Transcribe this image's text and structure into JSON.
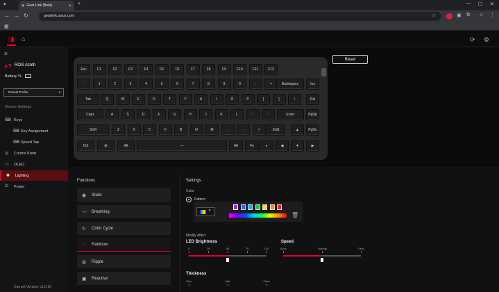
{
  "browser": {
    "tab_title": "Gear Link (Beta)",
    "url": "gearlink.asus.com"
  },
  "sidebar": {
    "brand": "ROG Azoth",
    "battery": "Battery %",
    "profile": "Default Profile",
    "section": "Device Settings",
    "items": [
      {
        "label": "Keys",
        "icon": "keyboard-icon"
      },
      {
        "label": "Key Assignment",
        "icon": "key-assign-icon"
      },
      {
        "label": "Speed Tap",
        "icon": "speed-tap-icon"
      },
      {
        "label": "Control Knob",
        "icon": "knob-icon"
      },
      {
        "label": "OLED",
        "icon": "oled-icon"
      },
      {
        "label": "Lighting",
        "icon": "lighting-icon"
      },
      {
        "label": "Power",
        "icon": "power-icon"
      }
    ],
    "version": "Current Version: v1.0.19"
  },
  "reset_label": "Reset",
  "keyboard": {
    "row1": [
      "Esc",
      "F1",
      "F2",
      "F3",
      "F4",
      "F5",
      "F6",
      "F7",
      "F8",
      "F9",
      "F10",
      "F11",
      "F12"
    ],
    "row2": [
      "`",
      "1",
      "2",
      "3",
      "4",
      "5",
      "6",
      "7",
      "8",
      "9",
      "0",
      "-",
      "=",
      "Backspace",
      "Ins"
    ],
    "row3": [
      "Tab",
      "Q",
      "W",
      "E",
      "R",
      "T",
      "Y",
      "U",
      "I",
      "O",
      "P",
      "[",
      "]",
      "\\",
      "Del"
    ],
    "row4": [
      "Caps",
      "A",
      "S",
      "D",
      "F",
      "G",
      "H",
      "J",
      "K",
      "L",
      ";",
      "'",
      "Enter",
      "PgUp"
    ],
    "row5": [
      "Shift",
      "Z",
      "X",
      "C",
      "V",
      "B",
      "N",
      "M",
      ",",
      ".",
      "/",
      "Shift",
      "▲",
      "PgDn"
    ],
    "row6": [
      "Ctrl",
      "⊞",
      "Alt",
      "—",
      "Alt",
      "Fn",
      "◕",
      "◀",
      "▼",
      "▶"
    ]
  },
  "functions": {
    "title": "Functions",
    "items": [
      {
        "label": "Static",
        "icon": "static-icon"
      },
      {
        "label": "Breathing",
        "icon": "breathing-icon"
      },
      {
        "label": "Color Cycle",
        "icon": "color-cycle-icon"
      },
      {
        "label": "Rainbow",
        "icon": "rainbow-icon"
      },
      {
        "label": "Ripple",
        "icon": "ripple-icon"
      },
      {
        "label": "Reactive",
        "icon": "reactive-icon"
      }
    ],
    "active": "Rainbow"
  },
  "settings": {
    "title": "Settings",
    "color_label": "Color",
    "pattern_label": "Pattern",
    "swatches": [
      "#c800ff",
      "#1e6bff",
      "#00b7ff",
      "#00d04c",
      "#f2e500",
      "#ff8a00",
      "#ff1a1a"
    ],
    "modify_label": "Modify effect",
    "brightness": {
      "label": "LED Brightness",
      "ticks": [
        "0",
        "25",
        "50",
        "75",
        "100"
      ],
      "value": 50
    },
    "speed": {
      "label": "Speed",
      "ticks": [
        "Slow",
        "Normal",
        "Fast"
      ],
      "value": 50
    },
    "thickness": {
      "label": "Thickness",
      "ticks": [
        "Slim",
        "Mid",
        "Thick"
      ]
    }
  },
  "colors": {
    "accent": "#e4002b"
  }
}
